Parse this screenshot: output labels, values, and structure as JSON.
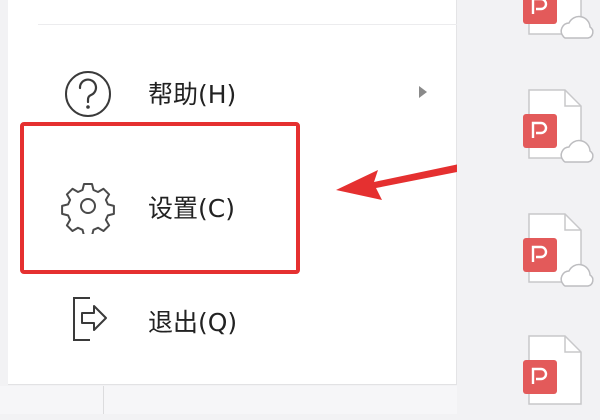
{
  "menu": {
    "items": [
      {
        "label": "帮助(H)",
        "icon": "help-icon",
        "has_submenu": true
      },
      {
        "label": "设置(C)",
        "icon": "gear-icon",
        "has_submenu": false
      },
      {
        "label": "退出(Q)",
        "icon": "exit-icon",
        "has_submenu": false
      }
    ]
  },
  "colors": {
    "highlight": "#e53030",
    "file_icon": "#e35a5a",
    "cloud": "#ffffff",
    "menu_bg": "#ffffff"
  },
  "file_icons": [
    "pdf-cloud-file-icon",
    "pdf-cloud-file-icon",
    "pdf-cloud-file-icon",
    "pdf-cloud-file-icon"
  ]
}
